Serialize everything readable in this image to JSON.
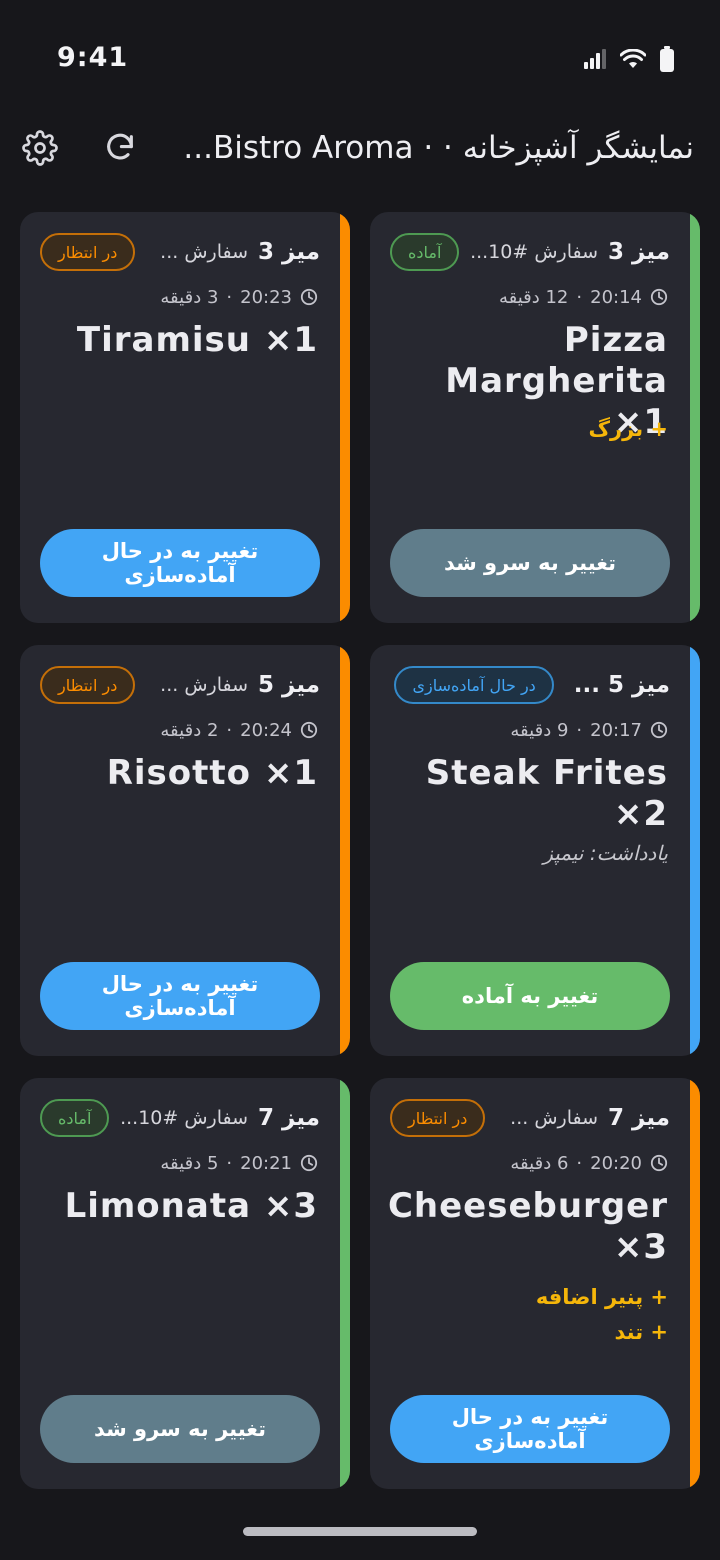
{
  "status_bar": {
    "time": "9:41"
  },
  "app_bar": {
    "title": "نمایشگر آشپزخانه · · Bistro Aroma..."
  },
  "colors": {
    "pending": "#fb8c00",
    "preparing": "#42a5f5",
    "ready": "#66bb6a",
    "served_button": "#607d8b",
    "modifier": "#f5b60a"
  },
  "orders": [
    {
      "table": "میز 3",
      "order": "سفارش #10...",
      "status": "آماده",
      "time": "20:14",
      "elapsed": "12 دقیقه",
      "item": "Pizza Margherita ×1",
      "modifiers": [
        "+ بزرگ"
      ],
      "note": "",
      "action": "تغییر به سرو شد"
    },
    {
      "table": "میز 3",
      "order": "سفارش ...",
      "status": "در انتظار",
      "time": "20:23",
      "elapsed": "3 دقیقه",
      "item": "Tiramisu ×1",
      "modifiers": [],
      "note": "",
      "action": "تغییر به در حال آماده‌سازی"
    },
    {
      "table": "میز 5 ...",
      "order": "",
      "status": "در حال آماده‌سازی",
      "time": "20:17",
      "elapsed": "9 دقیقه",
      "item": "Steak Frites ×2",
      "modifiers": [],
      "note": "یادداشت: نیمپز",
      "action": "تغییر به آماده"
    },
    {
      "table": "میز 5",
      "order": "سفارش ...",
      "status": "در انتظار",
      "time": "20:24",
      "elapsed": "2 دقیقه",
      "item": "Risotto ×1",
      "modifiers": [],
      "note": "",
      "action": "تغییر به در حال آماده‌سازی"
    },
    {
      "table": "میز 7",
      "order": "سفارش ...",
      "status": "در انتظار",
      "time": "20:20",
      "elapsed": "6 دقیقه",
      "item": "Cheeseburger ×3",
      "modifiers": [
        "+ پنیر اضافه",
        "+ تند"
      ],
      "note": "",
      "action": "تغییر به در حال آماده‌سازی"
    },
    {
      "table": "میز 7",
      "order": "سفارش #10...",
      "status": "آماده",
      "time": "20:21",
      "elapsed": "5 دقیقه",
      "item": "Limonata ×3",
      "modifiers": [],
      "note": "",
      "action": "تغییر به سرو شد"
    }
  ]
}
